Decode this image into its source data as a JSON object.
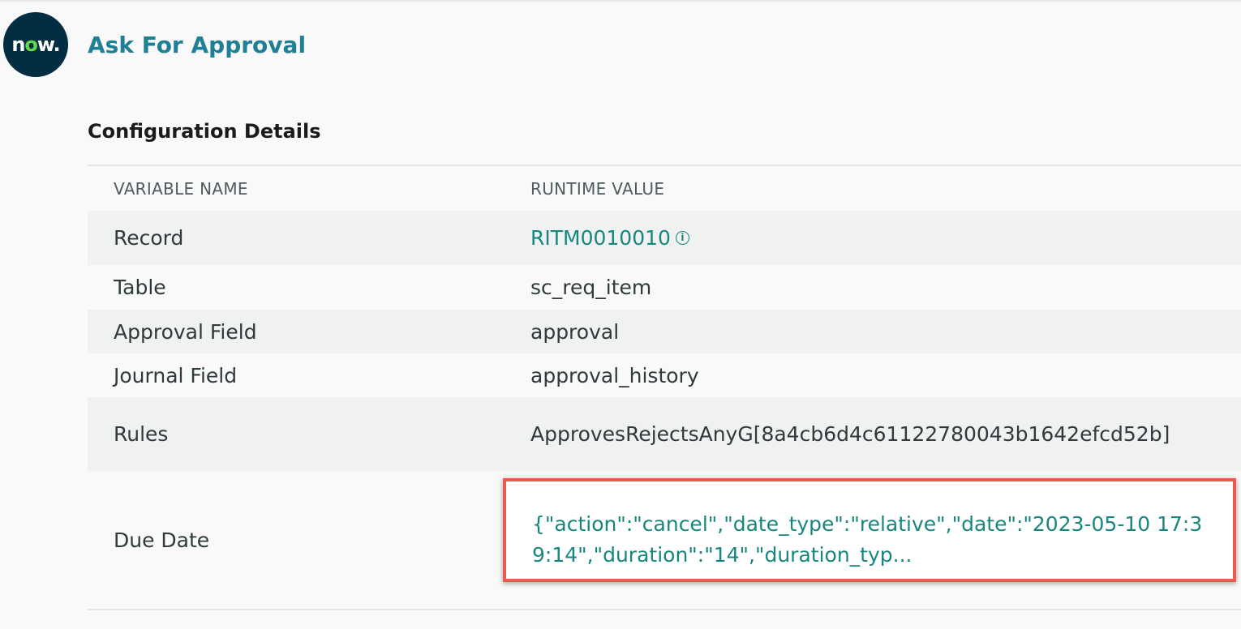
{
  "header": {
    "logo_text_n": "n",
    "logo_text_o": "o",
    "logo_text_w": "w.",
    "title": "Ask For Approval"
  },
  "section": {
    "title": "Configuration Details"
  },
  "table": {
    "columns": [
      "VARIABLE NAME",
      "RUNTIME VALUE"
    ],
    "rows": [
      {
        "name": "Record",
        "value": "RITM0010010"
      },
      {
        "name": "Table",
        "value": "sc_req_item"
      },
      {
        "name": "Approval Field",
        "value": "approval"
      },
      {
        "name": "Journal Field",
        "value": "approval_history"
      },
      {
        "name": "Rules",
        "value": "ApprovesRejectsAnyG[8a4cb6d4c61122780043b1642efcd52b]"
      },
      {
        "name": "Due Date",
        "value": "{\"action\":\"cancel\",\"date_type\":\"relative\",\"date\":\"2023-05-10 17:39:14\",\"duration\":\"14\",\"duration_typ..."
      }
    ]
  },
  "icons": {
    "info_glyph": "i"
  },
  "colors": {
    "brand_title": "#1f7f95",
    "link": "#17877e",
    "highlight_border": "#ec5b4f",
    "logo_bg": "#032d42",
    "logo_accent": "#62d84e"
  }
}
